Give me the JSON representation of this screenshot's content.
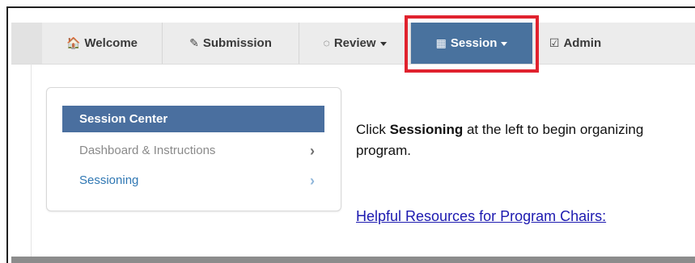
{
  "nav": {
    "tabs": [
      {
        "label": "Welcome",
        "icon": "home-icon",
        "glyph": "🏠"
      },
      {
        "label": "Submission",
        "icon": "pencil-icon",
        "glyph": "✎"
      },
      {
        "label": "Review",
        "icon": "comment-icon",
        "glyph": "◌",
        "dropdown": true
      },
      {
        "label": "Session",
        "icon": "calendar-icon",
        "glyph": "▦",
        "dropdown": true,
        "active": true
      },
      {
        "label": "Admin",
        "icon": "check-square-icon",
        "glyph": "☑"
      }
    ]
  },
  "panel": {
    "header": "Session Center",
    "items": [
      {
        "label": "Dashboard & Instructions",
        "chevron": "›"
      },
      {
        "label": "Sessioning",
        "chevron": "›"
      }
    ]
  },
  "message": {
    "prefix": "Click ",
    "bold": "Sessioning",
    "suffix": " at the left to begin organizing",
    "line2": "program."
  },
  "resources_link": "Helpful Resources for Program Chairs:",
  "colors": {
    "active_tab": "#49729e",
    "panel_header": "#4a6f9f",
    "highlight_box": "#e0222e",
    "link": "#1d1ab0",
    "sessioning_link": "#2f77b3"
  }
}
